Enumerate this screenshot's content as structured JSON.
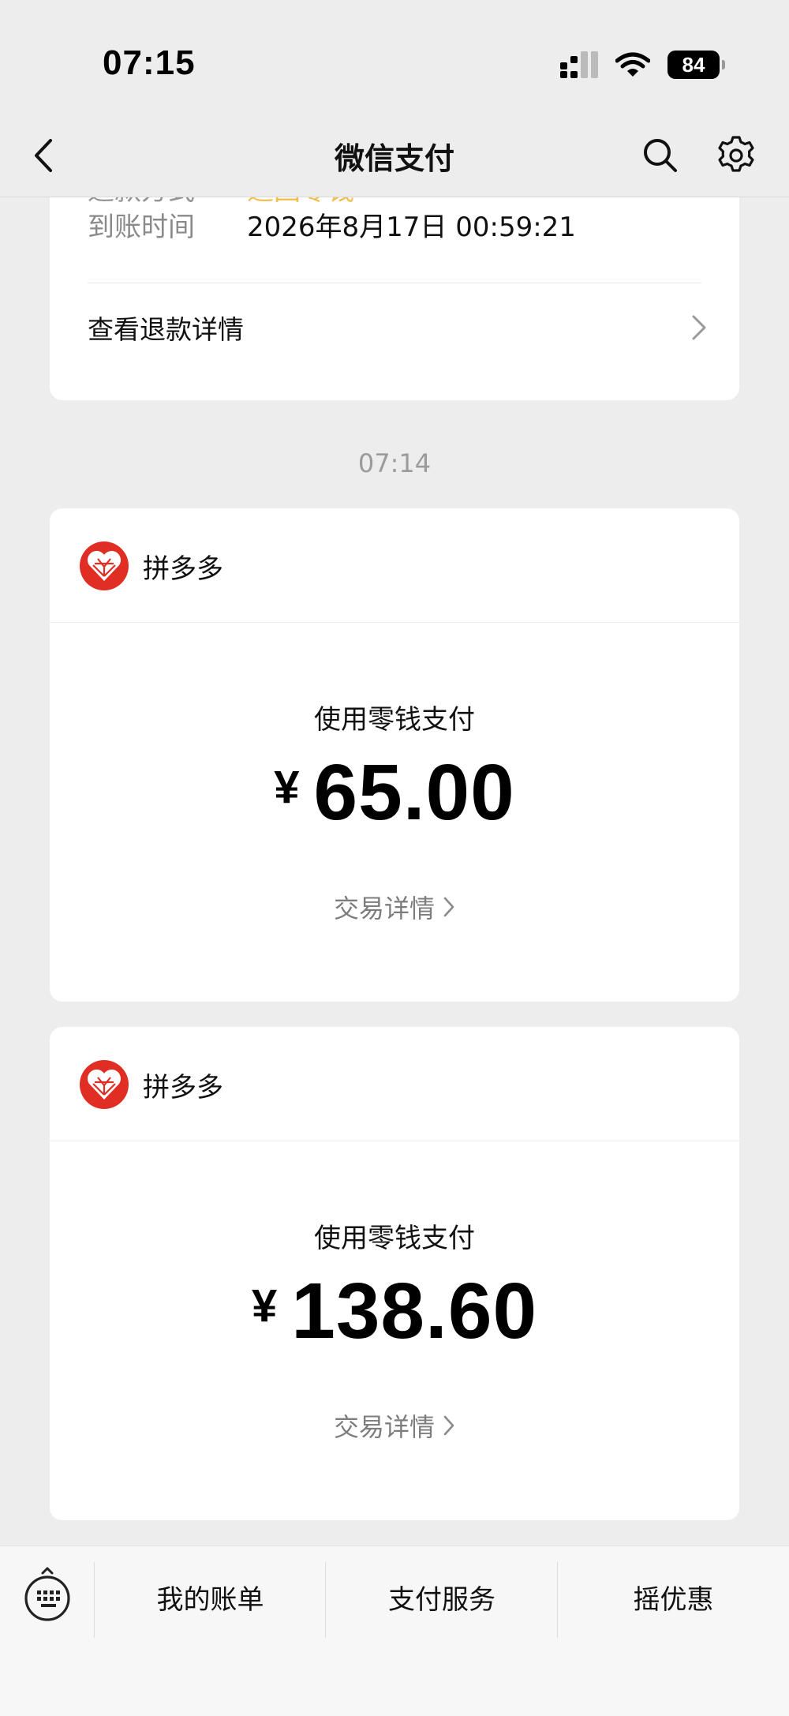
{
  "status_bar": {
    "time": "07:15",
    "battery": "84"
  },
  "nav": {
    "title": "微信支付",
    "back_icon": "chevron-left-icon",
    "search_icon": "search-icon",
    "settings_icon": "gear-icon"
  },
  "refund_card": {
    "method_label": "退款方式",
    "method_value": "退回零钱",
    "time_label": "到账时间",
    "time_value": "2026年8月17日 00:59:21",
    "detail_link": "查看退款详情"
  },
  "timestamp": "07:14",
  "payments": [
    {
      "merchant": "拼多多",
      "method": "使用零钱支付",
      "currency": "¥",
      "amount": "65.00",
      "detail_link": "交易详情"
    },
    {
      "merchant": "拼多多",
      "method": "使用零钱支付",
      "currency": "¥",
      "amount": "138.60",
      "detail_link": "交易详情"
    }
  ],
  "bottom_bar": {
    "keyboard_icon": "keyboard-icon",
    "items": [
      "我的账单",
      "支付服务",
      "摇优惠"
    ]
  },
  "colors": {
    "accent_orange": "#f3b73c",
    "merchant_red": "#e02e24",
    "background": "#ededed"
  }
}
